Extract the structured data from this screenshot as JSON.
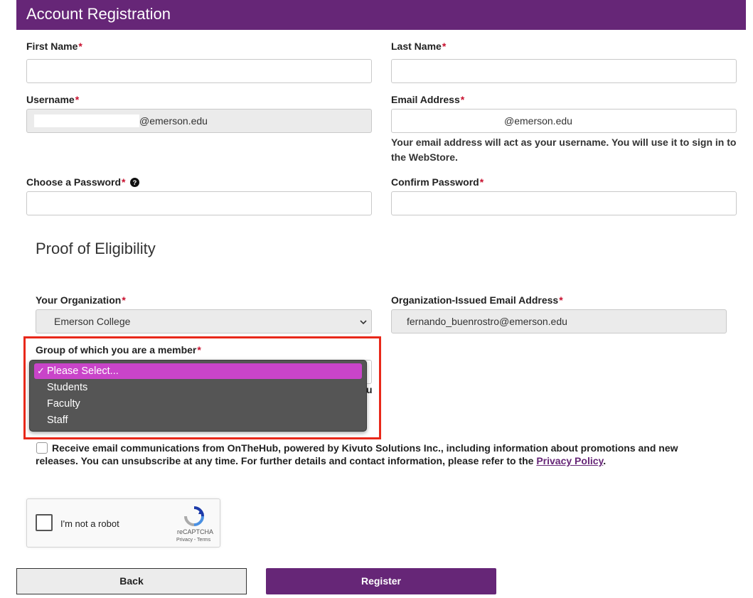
{
  "header": {
    "title": "Account Registration"
  },
  "fields": {
    "first_name": {
      "label": "First Name",
      "required_mark": "*",
      "value": ""
    },
    "last_name": {
      "label": "Last Name",
      "required_mark": "*",
      "value": ""
    },
    "username": {
      "label": "Username",
      "required_mark": "*",
      "domain_suffix": "@emerson.edu"
    },
    "email": {
      "label": "Email Address",
      "required_mark": "*",
      "value": "@emerson.edu",
      "help": "Your email address will act as your username. You will use it to sign in to the WebStore."
    },
    "password": {
      "label": "Choose a Password",
      "required_mark": "*",
      "help_icon": "question-circle-icon"
    },
    "confirm_password": {
      "label": "Confirm Password",
      "required_mark": "*"
    }
  },
  "eligibility": {
    "title": "Proof of Eligibility",
    "organization": {
      "label": "Your Organization",
      "required_mark": "*",
      "value": "Emerson College"
    },
    "org_email": {
      "label": "Organization-Issued Email Address",
      "required_mark": "*",
      "value": "fernando_buenrostro@emerson.edu"
    },
    "group": {
      "label": "Group of which you are a member",
      "required_mark": "*",
      "options": [
        "Please Select...",
        "Students",
        "Faculty",
        "Staff"
      ],
      "selected": "Please Select...",
      "check_glyph": "✓",
      "partial_text": "u"
    }
  },
  "consent": {
    "text": "Receive email communications from OnTheHub, powered by Kivuto Solutions Inc., including information about promotions and new releases. You can unsubscribe at any time. For further details and contact information, please refer to the",
    "link": "Privacy Policy",
    "end": "."
  },
  "captcha": {
    "label": "I'm not a robot",
    "brand": "reCAPTCHA",
    "links": "Privacy - Terms"
  },
  "buttons": {
    "back": "Back",
    "register": "Register"
  },
  "colors": {
    "brand_purple": "#662677",
    "highlight_magenta": "#c944c9",
    "callout_red": "#e8281a",
    "required_red": "#c8102e"
  }
}
